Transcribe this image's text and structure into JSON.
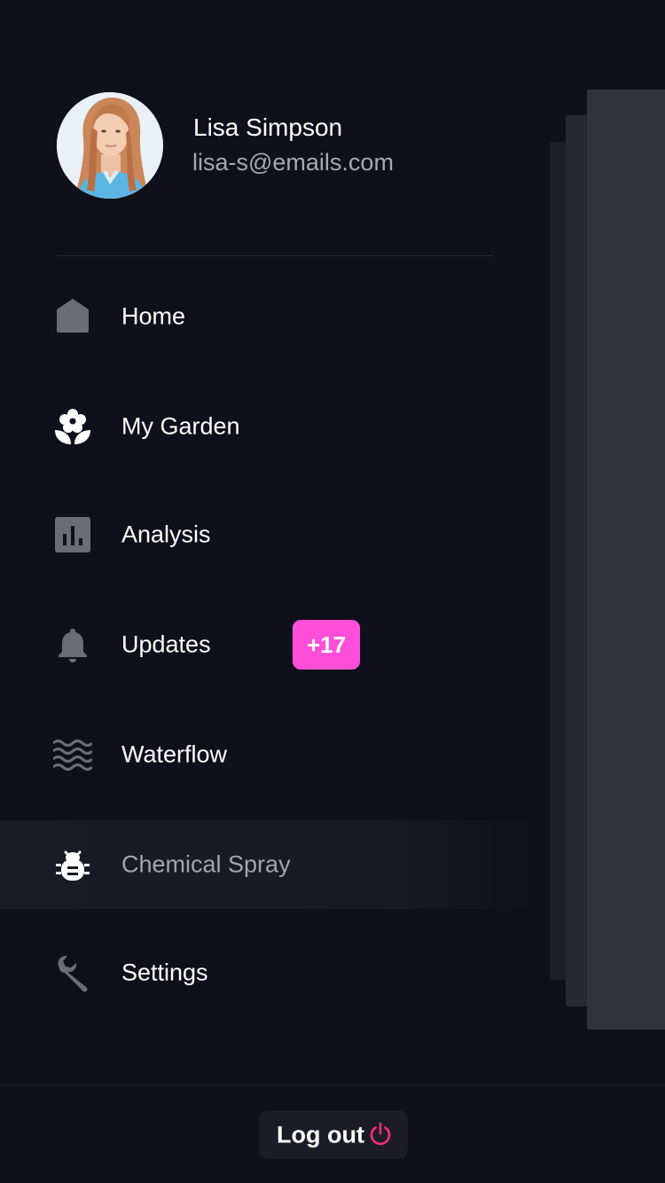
{
  "profile": {
    "name": "Lisa Simpson",
    "email": "lisa-s@emails.com",
    "avatar_icon": "user-avatar-photo"
  },
  "menu": {
    "items": [
      {
        "label": "Home",
        "icon": "home-icon"
      },
      {
        "label": "My Garden",
        "icon": "flower-icon"
      },
      {
        "label": "Analysis",
        "icon": "bar-chart-icon"
      },
      {
        "label": "Updates",
        "icon": "bell-icon",
        "badge": "+17"
      },
      {
        "label": "Waterflow",
        "icon": "waves-icon"
      },
      {
        "label": "Chemical Spray",
        "icon": "bug-icon",
        "active": true
      },
      {
        "label": "Settings",
        "icon": "wrench-icon"
      }
    ]
  },
  "logout": {
    "label": "Log out",
    "icon": "power-icon"
  },
  "colors": {
    "background": "#0f101c",
    "icon_gray": "#6b6c77",
    "badge": "#ff4fd8",
    "logout_icon": "#ff2d73",
    "active_row": "#181925"
  }
}
